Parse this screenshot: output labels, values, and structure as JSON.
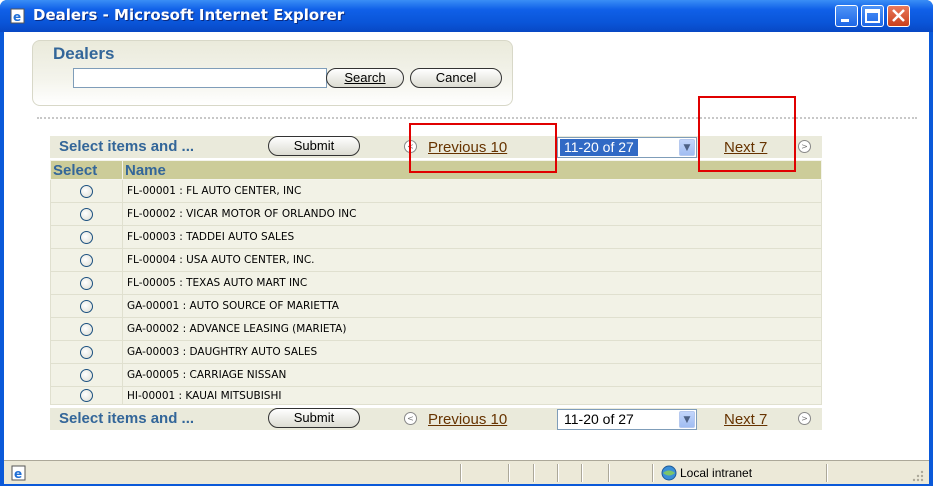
{
  "window": {
    "title": "Dealers - Microsoft Internet Explorer",
    "minimize": "_",
    "maximize": "□",
    "close": "✕"
  },
  "search": {
    "heading": "Dealers",
    "input_value": "",
    "search_label": "Search",
    "cancel_label": "Cancel"
  },
  "top_nav": {
    "label": "Select items and ...",
    "submit_label": "Submit",
    "previous_label": "Previous 10",
    "range_value": "11-20 of 27",
    "next_label": "Next 7"
  },
  "table": {
    "columns": [
      "Select",
      "Name"
    ],
    "rows": [
      {
        "name": "FL-00001 : FL AUTO CENTER, INC"
      },
      {
        "name": "FL-00002 : VICAR MOTOR OF ORLANDO INC"
      },
      {
        "name": "FL-00003 : TADDEI AUTO SALES"
      },
      {
        "name": "FL-00004 : USA AUTO CENTER, INC."
      },
      {
        "name": "FL-00005 : TEXAS AUTO MART INC"
      },
      {
        "name": "GA-00001 : AUTO SOURCE OF MARIETTA"
      },
      {
        "name": "GA-00002 : ADVANCE LEASING (MARIETA)"
      },
      {
        "name": "GA-00003 : DAUGHTRY AUTO SALES"
      },
      {
        "name": "GA-00005 : CARRIAGE NISSAN"
      },
      {
        "name": "HI-00001 : KAUAI MITSUBISHI"
      }
    ]
  },
  "bottom_nav": {
    "label": "Select items and ...",
    "submit_label": "Submit",
    "previous_label": "Previous 10",
    "range_value": "11-20 of 27",
    "next_label": "Next 7"
  },
  "status": {
    "zone": "Local intranet"
  },
  "colors": {
    "title_blue": "#0a55d8",
    "label_blue": "#336699",
    "header_tan": "#cccc99",
    "link_brown": "#663300",
    "highlight_red": "#e00000"
  }
}
